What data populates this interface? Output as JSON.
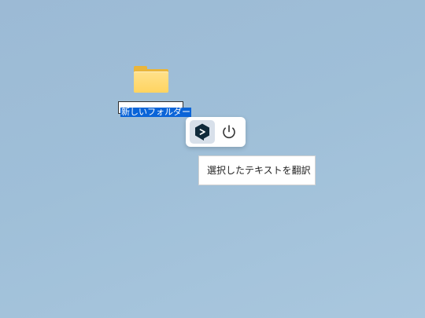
{
  "desktop": {
    "folder": {
      "name": "新しいフォルダー",
      "icon": "folder-icon"
    }
  },
  "translator_toolbar": {
    "translate_icon": "deepl-icon",
    "power_icon": "power-icon"
  },
  "tooltip": {
    "text": "選択したテキストを翻訳"
  }
}
